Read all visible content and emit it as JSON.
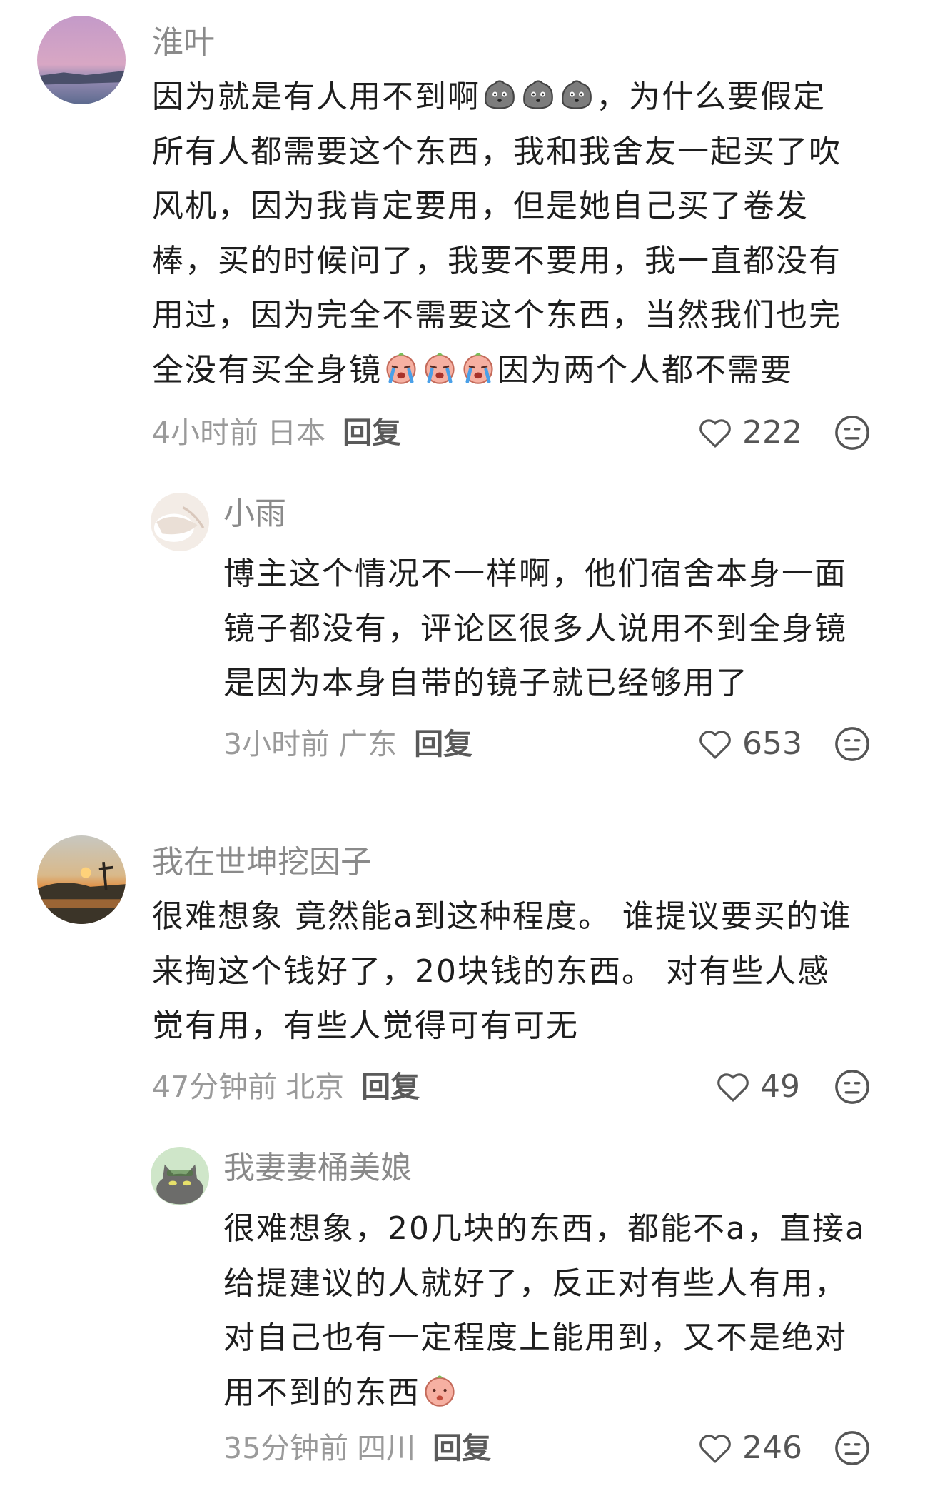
{
  "comments": [
    {
      "username": "淮叶",
      "lines": [
        [
          "因为就是有人用不到啊",
          "{rock}{rock}{rock}",
          "，为什么要假定"
        ],
        [
          "所有人都需要这个东西，我和我舍友一起买了吹"
        ],
        [
          "风机，因为我肯定要用，但是她自己买了卷发"
        ],
        [
          "棒，买的时候问了，我要不要用，我一直都没有"
        ],
        [
          "用过，因为完全不需要这个东西，当然我们也完"
        ],
        [
          "全没有买全身镜",
          "{cry}{cry}{cry}",
          "因为两个人都不需要"
        ]
      ],
      "time": "4小时前",
      "location": "日本",
      "reply_label": "回复",
      "likes": "222"
    },
    {
      "username": "小雨",
      "lines": [
        [
          "博主这个情况不一样啊，他们宿舍本身一面"
        ],
        [
          "镜子都没有，评论区很多人说用不到全身镜"
        ],
        [
          "是因为本身自带的镜子就已经够用了"
        ]
      ],
      "time": "3小时前",
      "location": "广东",
      "reply_label": "回复",
      "likes": "653"
    },
    {
      "username": "我在世坤挖因子",
      "lines": [
        [
          "很难想象 竟然能a到这种程度。 谁提议要买的谁"
        ],
        [
          "来掏这个钱好了，20块钱的东西。 对有些人感"
        ],
        [
          "觉有用，有些人觉得可有可无"
        ]
      ],
      "time": "47分钟前",
      "location": "北京",
      "reply_label": "回复",
      "likes": "49"
    },
    {
      "username": "我妻妻桶美娘",
      "lines": [
        [
          "很难想象，20几块的东西，都能不a，直接a"
        ],
        [
          "给提建议的人就好了，反正对有些人有用，"
        ],
        [
          "对自己也有一定程度上能用到，又不是绝对"
        ],
        [
          "用不到的东西",
          "{peach}"
        ]
      ],
      "time": "35分钟前",
      "location": "四川",
      "reply_label": "回复",
      "likes": "246"
    }
  ],
  "icons": {
    "like": "heart-outline-icon",
    "dislike": "neutral-face-icon"
  },
  "colors": {
    "username": "#8a8a8a",
    "body": "#1e1e1e",
    "meta": "#9a9a9a",
    "reply": "#5a5a5a"
  }
}
